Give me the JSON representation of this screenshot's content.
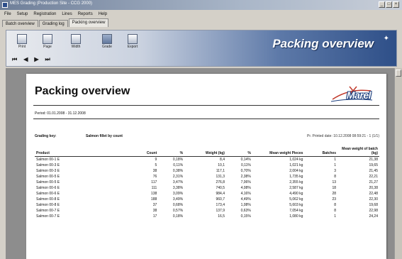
{
  "window": {
    "title": "MES Grading (Production Site - CCG 2000)",
    "controls": [
      "_",
      "□",
      "×"
    ]
  },
  "menu": [
    "File",
    "Setup",
    "Registration",
    "Lines",
    "Reports",
    "Help"
  ],
  "tabs": [
    {
      "label": "Batch overview",
      "active": false
    },
    {
      "label": "Grading log",
      "active": false
    },
    {
      "label": "Packing overview",
      "active": true
    }
  ],
  "toolbar": {
    "tools": [
      {
        "label": "Print",
        "icon": "printer-icon"
      },
      {
        "label": "Page",
        "icon": "page-setup-icon"
      },
      {
        "label": "Width",
        "icon": "page-width-icon"
      },
      {
        "label": "Grade",
        "icon": "grade-icon"
      },
      {
        "label": "Export",
        "icon": "export-icon"
      }
    ],
    "nav": [
      "⏮",
      "◀",
      "▶",
      "⏭"
    ],
    "banner_title": "Packing overview",
    "accent": "#2e4f88"
  },
  "report": {
    "title": "Packing overview",
    "logo": "Marel",
    "period": "Period: 01.01.2008 - 31.12.2008",
    "grading_label": "Grading key:",
    "grading_value": "Salmon fillet by count",
    "printed": "Pr. Printed date: 10.12.2008 08:59:21 - 1 (1/1)",
    "columns": [
      "Product",
      "Count",
      "%",
      "Weight (kg)",
      "%",
      "Mean weight Pieces",
      "Batches",
      "Mean weight of batch (kg)"
    ],
    "rows": [
      [
        "Salmon 00-1 E",
        "9",
        "0,18%",
        "8,4",
        "0,14%",
        "1,024 kg",
        "1",
        "21,38"
      ],
      [
        "Salmon 00-3 E",
        "5",
        "0,11%",
        "10,1",
        "0,11%",
        "1,021 kg",
        "1",
        "19,65"
      ],
      [
        "Salmon 00-3 E",
        "38",
        "0,38%",
        "117,1",
        "0,70%",
        "2,004 kg",
        "3",
        "21,45"
      ],
      [
        "Salmon 00-5 E",
        "76",
        "2,31%",
        "131,3",
        "2,38%",
        "1,735 kg",
        "8",
        "22,21"
      ],
      [
        "Salmon 00-5 E",
        "117",
        "3,47%",
        "276,8",
        "7,06%",
        "2,355 kg",
        "13",
        "21,27"
      ],
      [
        "Salmon 00-6 E",
        "111",
        "3,38%",
        "740,5",
        "4,08%",
        "2,587 kg",
        "18",
        "20,38"
      ],
      [
        "Salmon 00-6 E",
        "138",
        "3,09%",
        "984,4",
        "4,16%",
        "4,490 kg",
        "28",
        "22,48"
      ],
      [
        "Salmon 00-8 E",
        "188",
        "3,49%",
        "960,7",
        "4,49%",
        "5,062 kg",
        "23",
        "22,30"
      ],
      [
        "Salmon 00-8 E",
        "37",
        "0,68%",
        "173,4",
        "1,08%",
        "5,603 kg",
        "8",
        "19,68"
      ],
      [
        "Salmon 00-7 E",
        "38",
        "0,57%",
        "137,9",
        "0,63%",
        "7,054 kg",
        "8",
        "22,98"
      ],
      [
        "Salmon 00-7 E",
        "17",
        "0,18%",
        "16,5",
        "0,15%",
        "1,080 kg",
        "1",
        "24,24"
      ]
    ]
  }
}
